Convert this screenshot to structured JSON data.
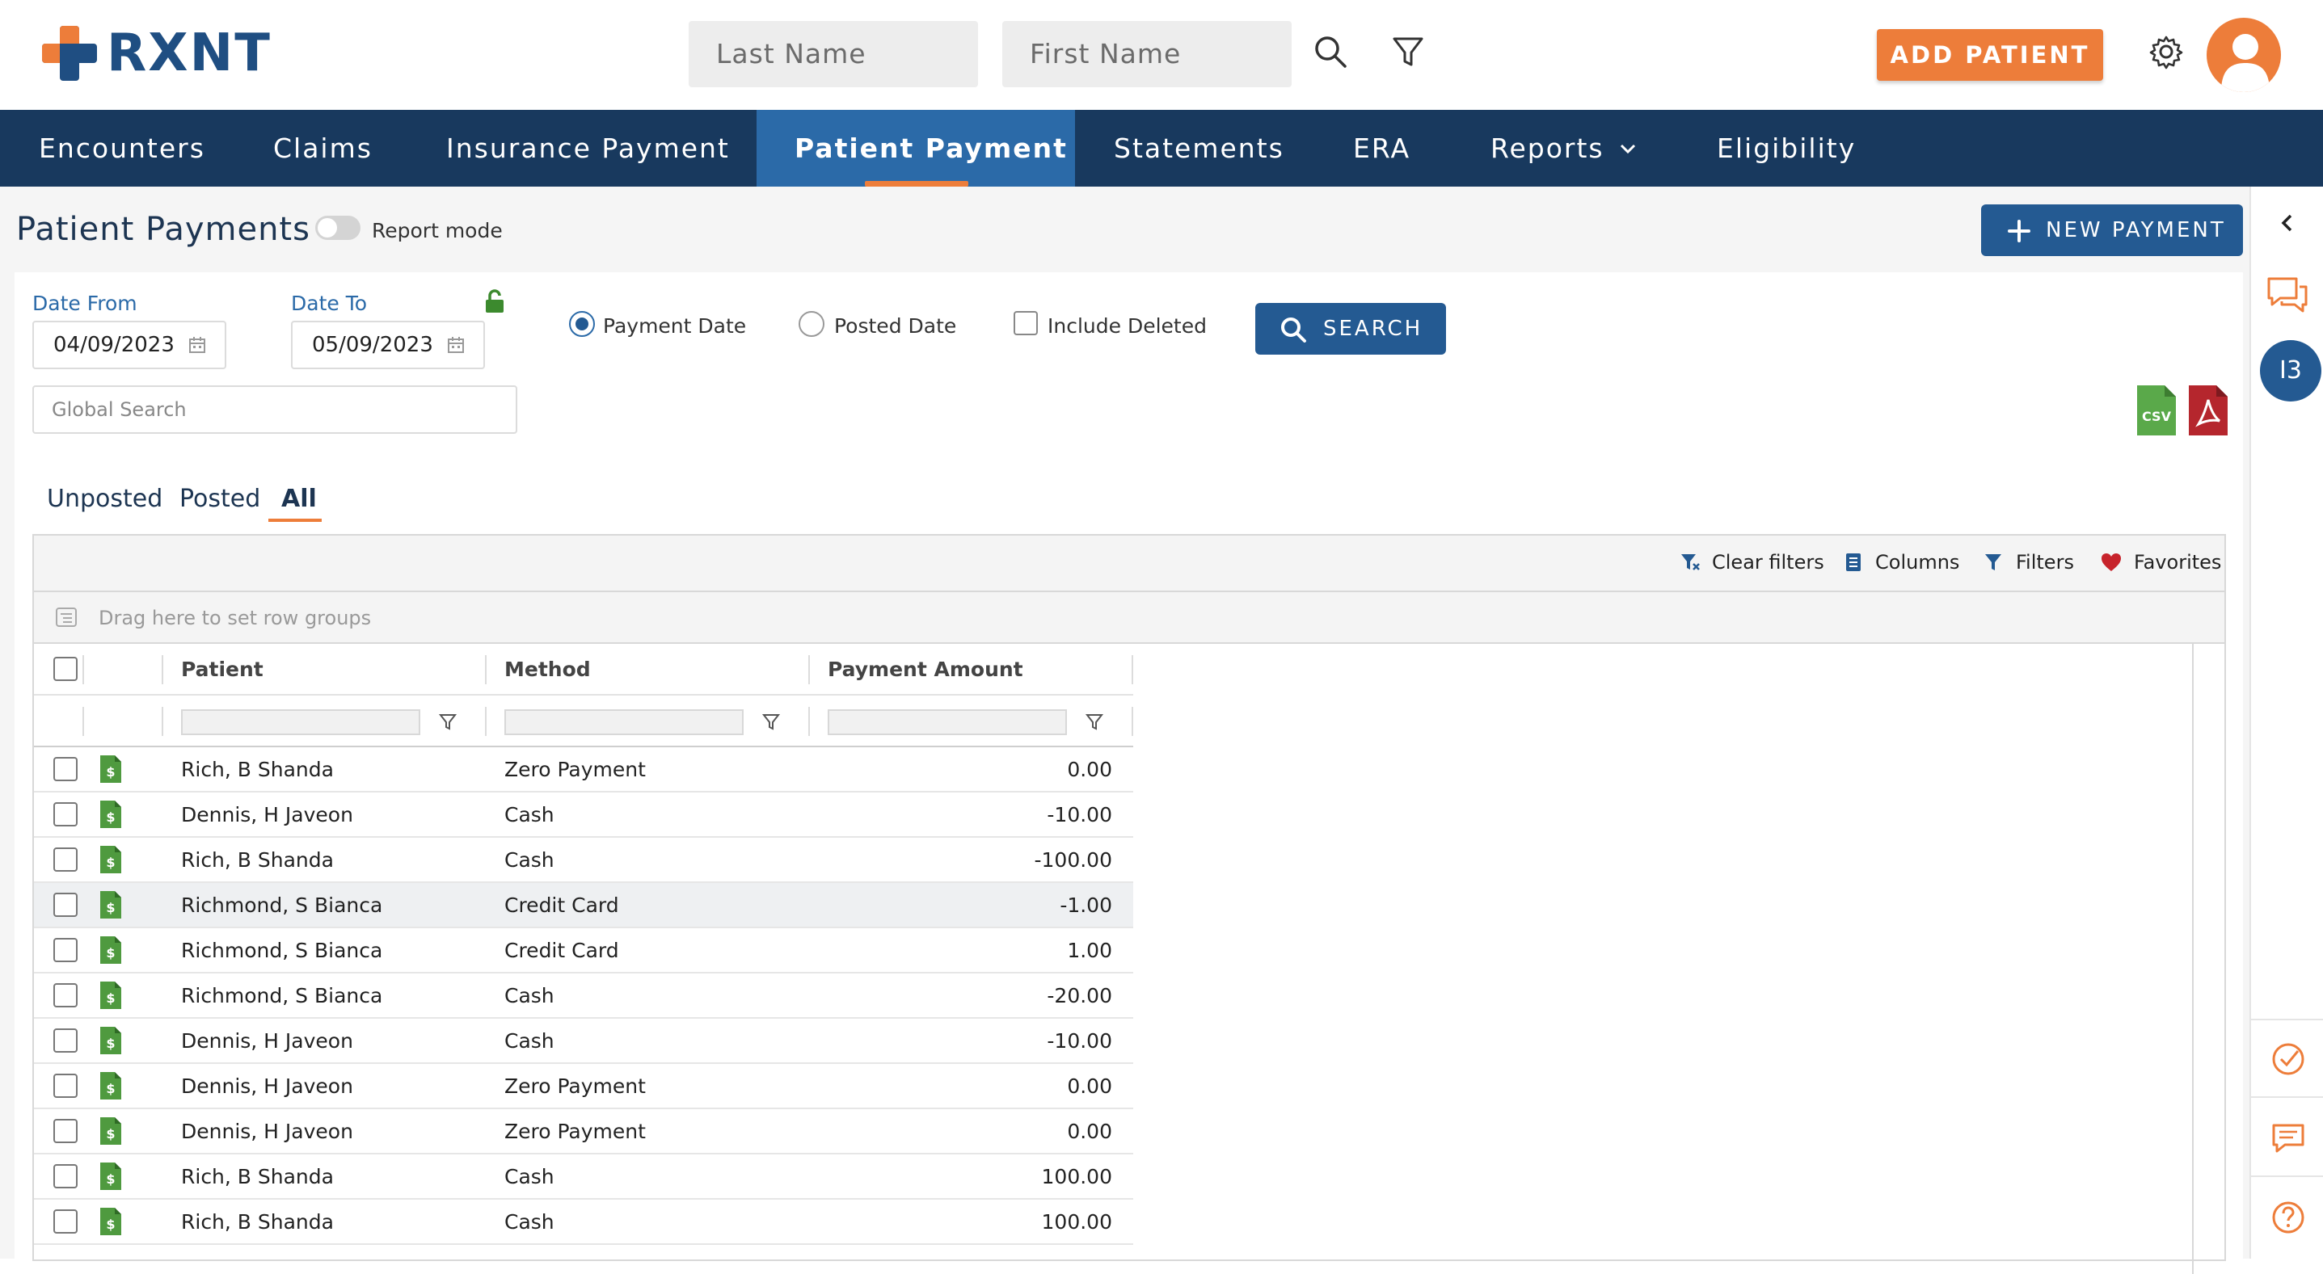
{
  "header": {
    "brand": "RXNT",
    "last_name_placeholder": "Last Name",
    "first_name_placeholder": "First Name",
    "add_patient_label": "ADD PATIENT",
    "colors": {
      "brand_blue": "#1f4e82",
      "accent_orange": "#ed7d3a"
    }
  },
  "nav": {
    "items": [
      {
        "label": "Encounters"
      },
      {
        "label": "Claims"
      },
      {
        "label": "Insurance Payment"
      },
      {
        "label": "Patient Payment",
        "active": true
      },
      {
        "label": "Statements"
      },
      {
        "label": "ERA"
      },
      {
        "label": "Reports",
        "has_dropdown": true
      },
      {
        "label": "Eligibility"
      }
    ]
  },
  "page": {
    "title": "Patient Payments",
    "report_mode_label": "Report mode",
    "report_mode_on": false,
    "new_payment_label": "NEW PAYMENT"
  },
  "filters": {
    "date_from_label": "Date From",
    "date_from_value": "04/09/2023",
    "date_to_label": "Date To",
    "date_to_value": "05/09/2023",
    "payment_date_label": "Payment Date",
    "posted_date_label": "Posted Date",
    "selected_date_type": "Payment Date",
    "include_deleted_label": "Include Deleted",
    "include_deleted_checked": false,
    "search_label": "SEARCH",
    "global_search_placeholder": "Global Search"
  },
  "export": {
    "csv_label": "CSV"
  },
  "subtabs": {
    "items": [
      {
        "label": "Unposted"
      },
      {
        "label": "Posted"
      },
      {
        "label": "All",
        "active": true
      }
    ]
  },
  "grid": {
    "toolbar": {
      "clear_filters": "Clear filters",
      "columns": "Columns",
      "filters": "Filters",
      "favorites": "Favorites"
    },
    "row_group_hint": "Drag here to set row groups",
    "columns": [
      "Patient",
      "Method",
      "Payment Amount"
    ],
    "rows": [
      {
        "patient": "Rich, B Shanda",
        "method": "Zero Payment",
        "amount": "0.00"
      },
      {
        "patient": "Dennis, H Javeon",
        "method": "Cash",
        "amount": "-10.00"
      },
      {
        "patient": "Rich, B Shanda",
        "method": "Cash",
        "amount": "-100.00"
      },
      {
        "patient": "Richmond, S Bianca",
        "method": "Credit Card",
        "amount": "-1.00",
        "highlighted": true
      },
      {
        "patient": "Richmond, S Bianca",
        "method": "Credit Card",
        "amount": "1.00"
      },
      {
        "patient": "Richmond, S Bianca",
        "method": "Cash",
        "amount": "-20.00"
      },
      {
        "patient": "Dennis, H Javeon",
        "method": "Cash",
        "amount": "-10.00"
      },
      {
        "patient": "Dennis, H Javeon",
        "method": "Zero Payment",
        "amount": "0.00"
      },
      {
        "patient": "Dennis, H Javeon",
        "method": "Zero Payment",
        "amount": "0.00"
      },
      {
        "patient": "Rich, B Shanda",
        "method": "Cash",
        "amount": "100.00"
      },
      {
        "patient": "Rich, B Shanda",
        "method": "Cash",
        "amount": "100.00"
      }
    ]
  },
  "rail": {
    "badge_text": "I3"
  }
}
